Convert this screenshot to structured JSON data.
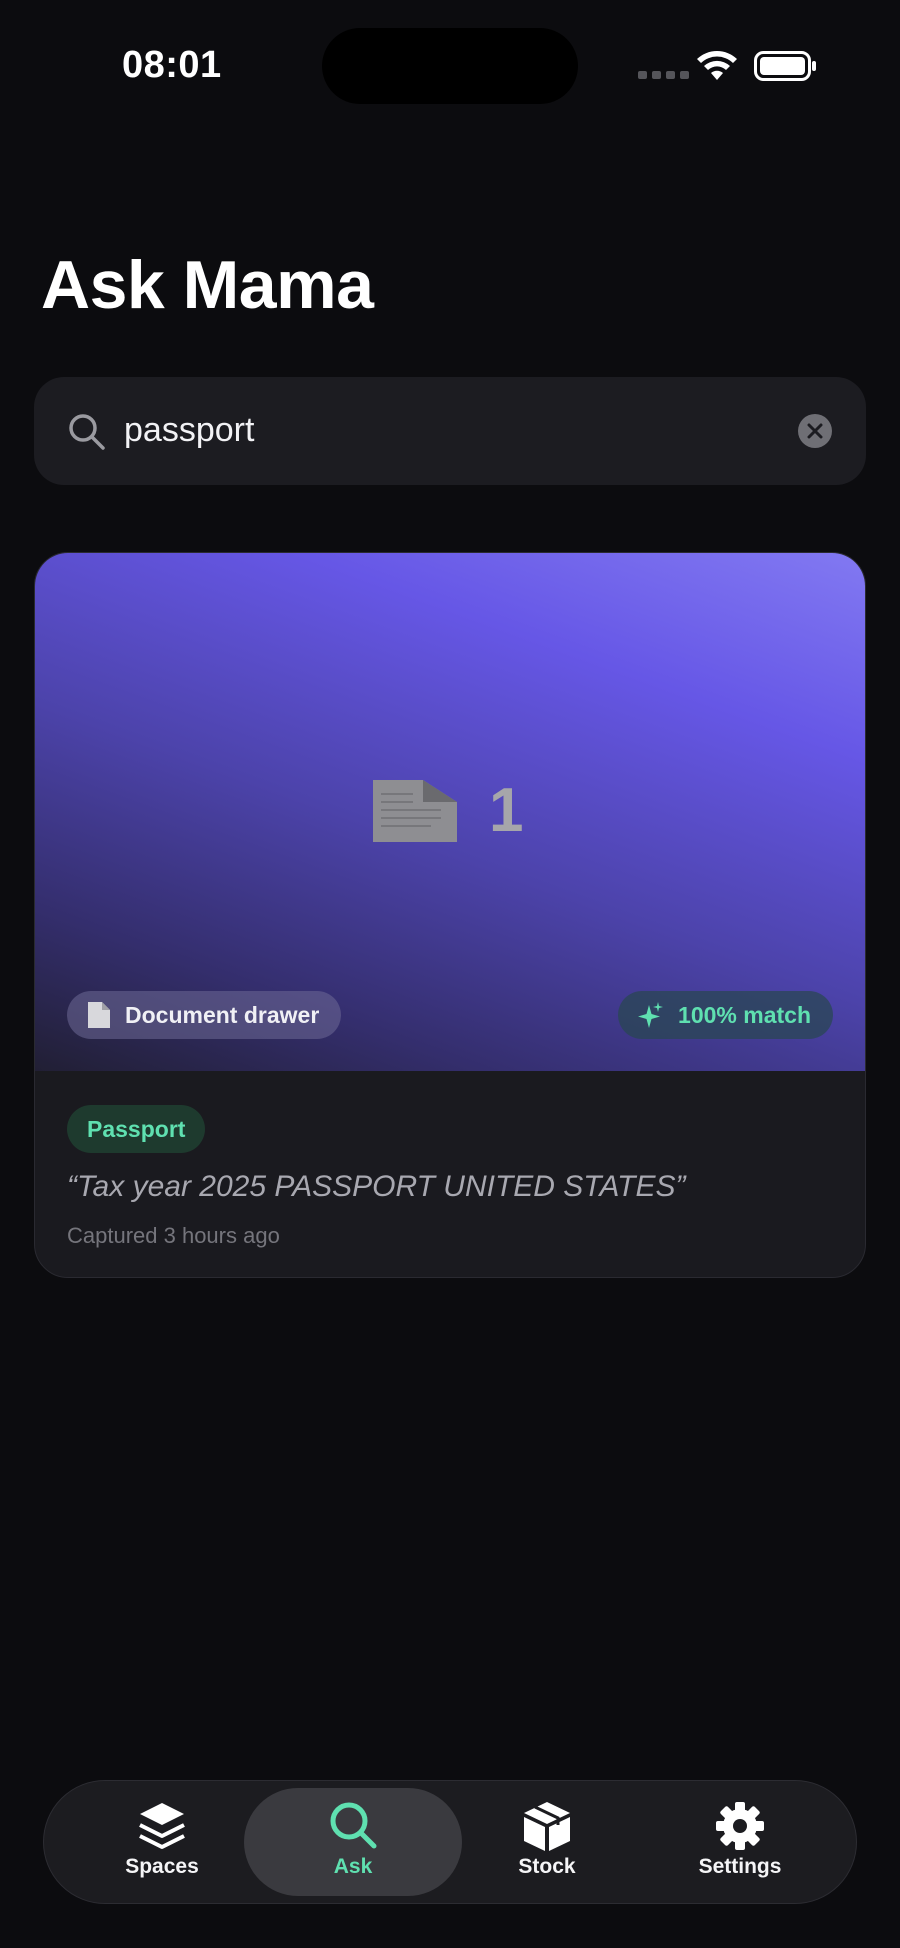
{
  "status_bar": {
    "time": "08:01"
  },
  "page": {
    "title": "Ask Mama"
  },
  "search": {
    "value": "passport",
    "placeholder": ""
  },
  "result": {
    "count": "1",
    "source_label": "Document drawer",
    "match_label": "100% match",
    "tag": "Passport",
    "quote": "“Tax year 2025 PASSPORT UNITED STATES”",
    "captured": "Captured 3 hours ago"
  },
  "tabs": [
    {
      "label": "Spaces",
      "icon": "stack-icon"
    },
    {
      "label": "Ask",
      "icon": "search-icon",
      "active": true
    },
    {
      "label": "Stock",
      "icon": "box-icon"
    },
    {
      "label": "Settings",
      "icon": "gear-icon"
    }
  ],
  "colors": {
    "accent": "#5fe0b0",
    "background": "#0c0c0f",
    "card": "#1a1a1f"
  }
}
